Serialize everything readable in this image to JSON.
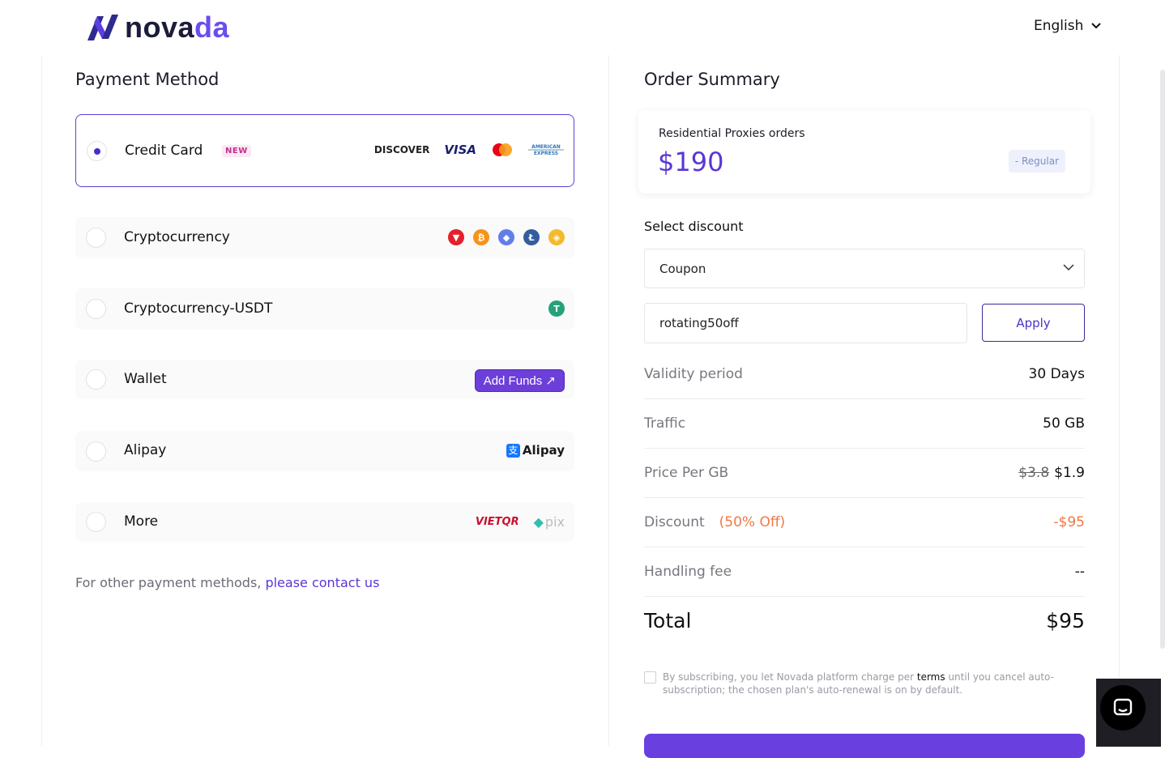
{
  "header": {
    "logo_prefix": "nova",
    "logo_accent": "da",
    "language": "English"
  },
  "payment": {
    "title": "Payment Method",
    "methods": [
      {
        "label": "Credit Card",
        "badge": "NEW",
        "selected": true
      },
      {
        "label": "Cryptocurrency",
        "selected": false
      },
      {
        "label": "Cryptocurrency-USDT",
        "selected": false
      },
      {
        "label": "Wallet",
        "selected": false,
        "action": "Add Funds ↗"
      },
      {
        "label": "Alipay",
        "selected": false,
        "brand": "Alipay"
      },
      {
        "label": "More",
        "selected": false,
        "brand": "VIETQR",
        "brand2": "pix"
      }
    ],
    "card_brands": [
      "DISCOVER",
      "VISA",
      "mastercard",
      "AMERICAN EXPRESS"
    ],
    "other_text": "For other payment methods, ",
    "other_link": "please contact us"
  },
  "summary": {
    "title": "Order Summary",
    "product": "Residential Proxies orders",
    "price": "$190",
    "plan_tag": "- Regular",
    "select_discount": "Select discount",
    "discount_type": "Coupon",
    "coupon_code": "rotating50off",
    "apply": "Apply",
    "rows": {
      "validity": {
        "k": "Validity period",
        "v": "30 Days"
      },
      "traffic": {
        "k": "Traffic",
        "v": "50 GB"
      },
      "price_per_gb": {
        "k": "Price Per GB",
        "old": "$3.8",
        "v": "$1.9"
      },
      "discount": {
        "k": "Discount",
        "off": "(50% Off)",
        "v": "-$95"
      },
      "handling": {
        "k": "Handling fee",
        "v": "--"
      }
    },
    "total_label": "Total",
    "total_value": "$95",
    "consent_pre": "By subscribing, you let Novada platform charge per ",
    "consent_terms": "terms",
    "consent_post": " until you cancel auto-subscription; the chosen plan's auto-renewal is on by default."
  },
  "colors": {
    "accent": "#5a36d6",
    "orange": "#f07845"
  }
}
